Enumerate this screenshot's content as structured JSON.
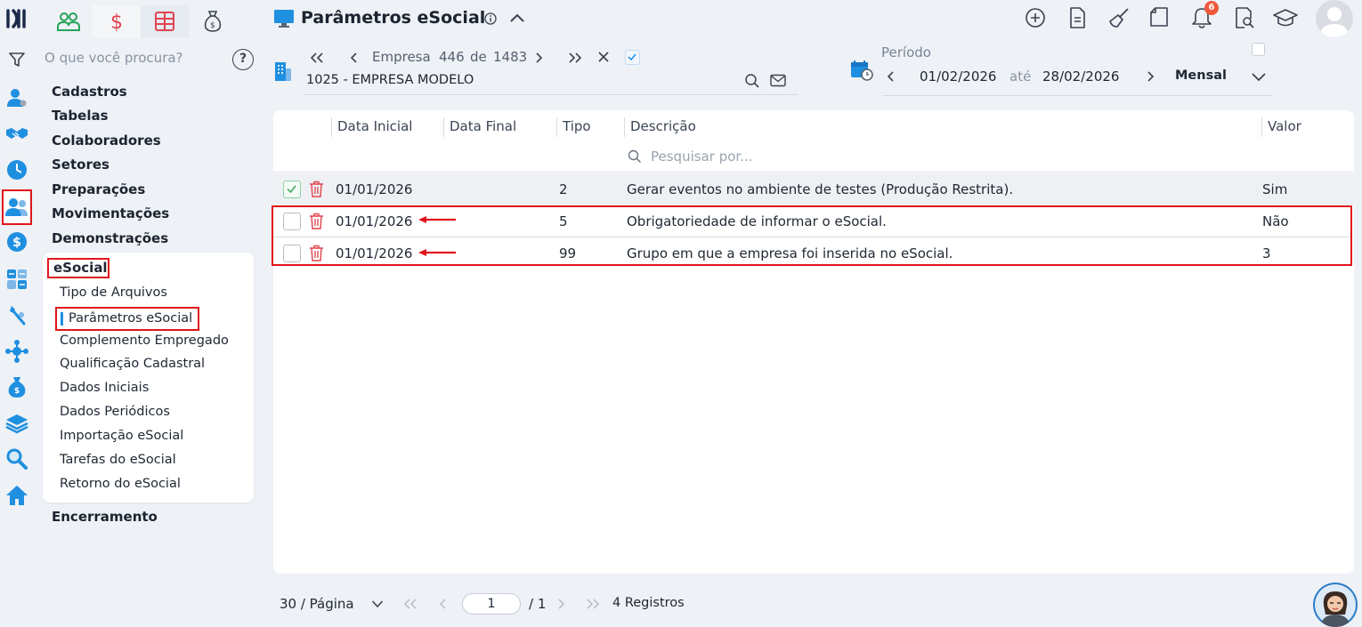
{
  "header": {
    "title": "Parâmetros eSocial",
    "notification_count": "6"
  },
  "sidebar": {
    "search_placeholder": "O que você procura?",
    "help": "?",
    "menu": [
      "Cadastros",
      "Tabelas",
      "Colaboradores",
      "Setores",
      "Preparações",
      "Movimentações",
      "Demonstrações"
    ],
    "section": "eSocial",
    "submenu": [
      "Tipo de Arquivos",
      "Parâmetros eSocial",
      "Complemento Empregado",
      "Qualificação Cadastral",
      "Dados Iniciais",
      "Dados Periódicos",
      "Importação eSocial",
      "Tarefas do eSocial",
      "Retorno do eSocial"
    ],
    "after": "Encerramento"
  },
  "company_nav": {
    "label": "Empresa",
    "current": "446",
    "of": "de",
    "total": "1483",
    "company": "1025 - EMPRESA MODELO"
  },
  "period": {
    "label": "Período",
    "start": "01/02/2026",
    "until": "até",
    "end": "28/02/2026",
    "mode": "Mensal"
  },
  "table": {
    "headers": [
      "Data Inicial",
      "Data Final",
      "Tipo",
      "Descrição",
      "Valor"
    ],
    "filter_placeholder": "Pesquisar por...",
    "rows": [
      {
        "data_inicial": "01/01/2026",
        "tipo": "2",
        "descricao": "Gerar eventos no ambiente de testes (Produção Restrita).",
        "valor": "Sim",
        "checked": true
      },
      {
        "data_inicial": "01/01/2026",
        "tipo": "5",
        "descricao": "Obrigatoriedade de informar o eSocial.",
        "valor": "Não",
        "checked": false
      },
      {
        "data_inicial": "01/01/2026",
        "tipo": "99",
        "descricao": "Grupo em que a empresa foi inserida no eSocial.",
        "valor": "3",
        "checked": false
      }
    ]
  },
  "footer": {
    "per_page": "30 / Página",
    "page": "1",
    "total_pages": "/ 1",
    "records": "4 Registros"
  },
  "colors": {
    "accent": "#1f8fe0",
    "highlight": "#e0161b",
    "delete": "#e0434a",
    "check": "#3ba55c"
  }
}
